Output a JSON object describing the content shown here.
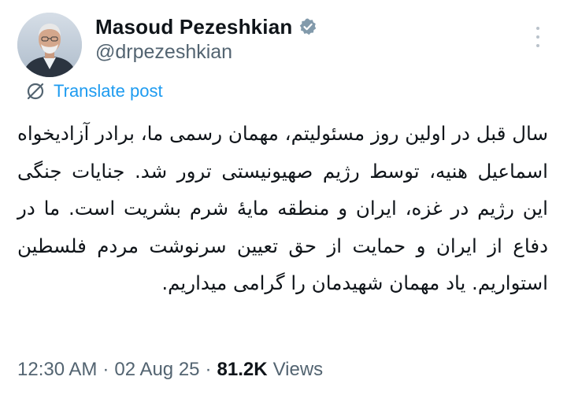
{
  "author": {
    "display_name": "Masoud Pezeshkian",
    "handle": "@drpezeshkian",
    "verified": true
  },
  "translate": {
    "label": "Translate post",
    "icon": "globe-slash-icon"
  },
  "post": {
    "text": "سال قبل در اولین روز مسئولیتم، مهمان رسمی ما، برادر آزادیخواه اسماعیل هنیه، توسط رژیم صهیونیستی ترور شد. جنایات جنگی این رژیم در غزه، ایران و منطقه مایهٔ شرم بشریت است. ما در دفاع از ایران و حمایت از حق تعیین سرنوشت مردم فلسطین استواریم. یاد مهمان شهیدمان را گرامی میداریم."
  },
  "meta": {
    "time": "12:30 AM",
    "date": "02 Aug 25",
    "views_count": "81.2K",
    "views_label": "Views",
    "separator": "·"
  },
  "colors": {
    "accent": "#1d9bf0",
    "secondary_text": "#536471",
    "primary_text": "#0f1419",
    "verified_badge": "#829aab"
  },
  "icons": {
    "more": "more-options-icon",
    "verified": "verified-badge-icon"
  }
}
